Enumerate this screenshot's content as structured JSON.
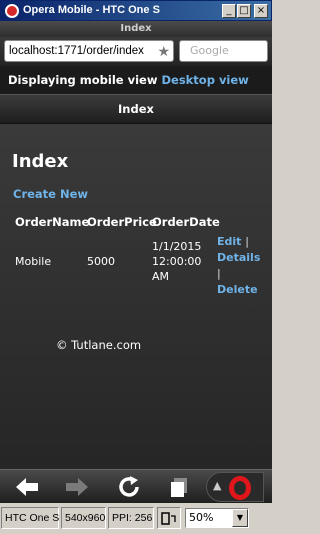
{
  "window": {
    "title": "Opera Mobile - HTC One S",
    "minimize": "_",
    "maximize": "□",
    "close": "×"
  },
  "browser": {
    "tab_title": "Index",
    "url": "localhost:1771/order/index",
    "search_placeholder": "Google",
    "view_text": "Displaying mobile view",
    "desktop_view_link": "Desktop view"
  },
  "page": {
    "header": "Index",
    "heading": "Index",
    "create_link": "Create New",
    "columns": [
      "OrderName",
      "OrderPrice",
      "OrderDate"
    ],
    "row": {
      "name": "Mobile",
      "price": "5000",
      "date_line1": "1/1/2015",
      "date_line2": "12:00:00",
      "date_line3": "AM",
      "edit": "Edit",
      "details": "Details",
      "delete": "Delete",
      "separator": "|"
    },
    "credit": "© Tutlane.com"
  },
  "statusbar": {
    "device": "HTC One S",
    "resolution": "540x960",
    "ppi": "PPI: 256",
    "zoom": "50%"
  },
  "icons": {
    "back": "back-arrow-icon",
    "forward": "forward-arrow-icon",
    "reload": "reload-icon",
    "tabs": "tabs-icon",
    "menu": "opera-menu-icon"
  }
}
